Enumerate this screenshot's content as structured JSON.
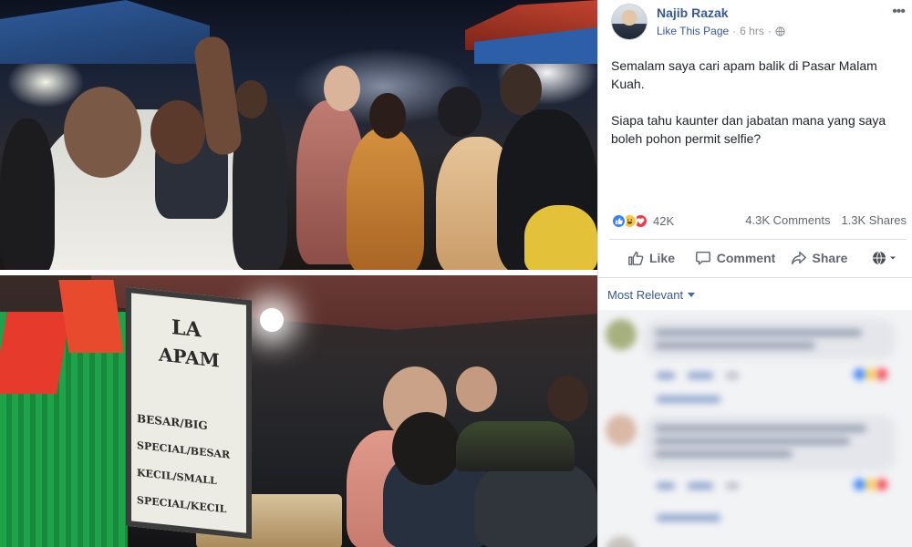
{
  "post": {
    "author": "Najib Razak",
    "like_page": "Like This Page",
    "separator": "·",
    "time": "6 hrs",
    "more": "•••",
    "text_line1": "Semalam saya cari apam balik di Pasar Malam Kuah.",
    "text_line2": "Siapa tahu kaunter dan jabatan mana yang saya boleh pohon permit selfie?",
    "reaction_count": "42K",
    "comments_count": "4.3K Comments",
    "shares_count": "1.3K Shares"
  },
  "actions": {
    "like": "Like",
    "comment": "Comment",
    "share": "Share"
  },
  "filter": {
    "label": "Most Relevant"
  },
  "photo": {
    "sign_line1": "LA",
    "sign_line2": "APAM",
    "sign_line3": "BESAR/BIG",
    "sign_line4": "SPECIAL/BESAR",
    "sign_line5": "KECIL/SMALL",
    "sign_line6": "SPECIAL/KECIL"
  },
  "icons": {
    "globe": "globe-icon",
    "like": "thumbs-up-icon",
    "comment": "speech-bubble-icon",
    "share": "share-arrow-icon",
    "audience": "globe-dropdown-icon"
  },
  "colors": {
    "link": "#365899",
    "like_blue": "#3b82f0",
    "love_red": "#f0394c",
    "haha_yellow": "#f7c844",
    "muted": "#606770"
  }
}
